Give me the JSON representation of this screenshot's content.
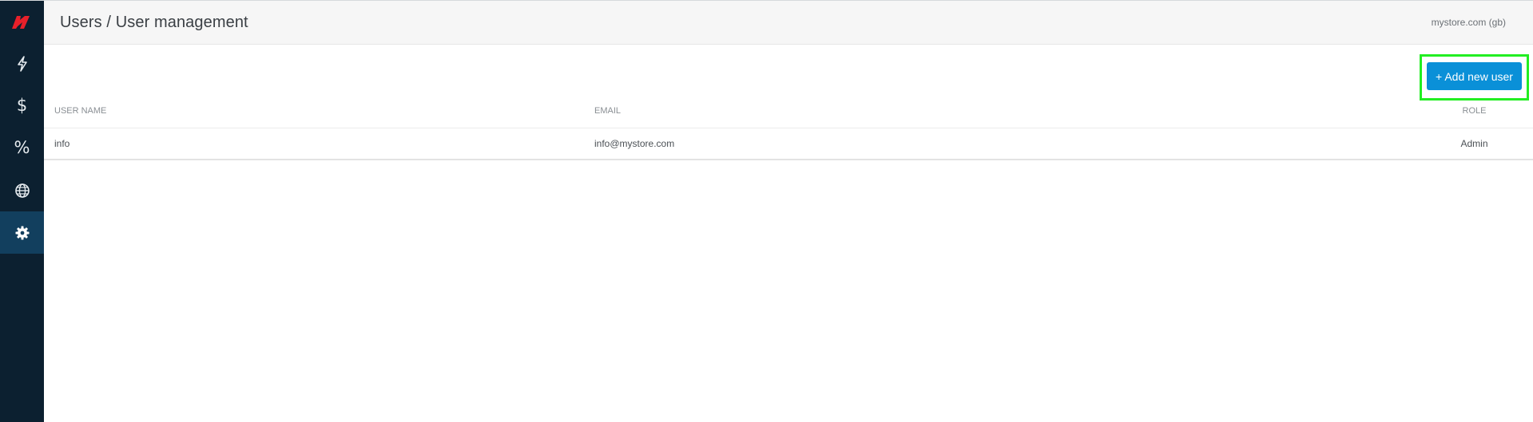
{
  "sidebar": {
    "logo_icon": "brand-logo-icon",
    "items": [
      {
        "icon": "lightning-icon",
        "active": false
      },
      {
        "icon": "dollar-icon",
        "active": false
      },
      {
        "icon": "percent-icon",
        "active": false
      },
      {
        "icon": "globe-icon",
        "active": false
      },
      {
        "icon": "gear-icon",
        "active": true
      }
    ],
    "colors": {
      "background": "#0c2030",
      "active": "#123f5e",
      "logo": "#e8202a"
    }
  },
  "header": {
    "title": "Users / User management",
    "store": "mystore.com (gb)"
  },
  "toolbar": {
    "add_user_label": "+ Add new user",
    "button_color": "#0a90d8",
    "highlight_color": "#22ee22"
  },
  "table": {
    "columns": {
      "user_name": "USER NAME",
      "email": "EMAIL",
      "role": "ROLE"
    },
    "rows": [
      {
        "user_name": "info",
        "email": "info@mystore.com",
        "role": "Admin"
      }
    ]
  }
}
